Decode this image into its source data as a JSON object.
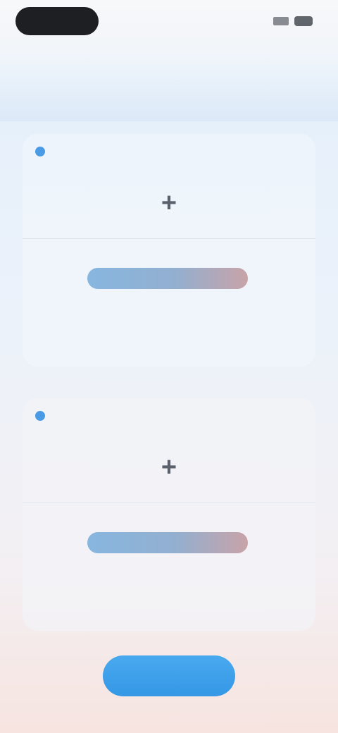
{
  "status_bar": {
    "time": "",
    "signal_icon": "signal-icon",
    "battery_icon": "battery-icon"
  },
  "cards": [
    {
      "title": "",
      "add_icon": "plus-icon",
      "button_label": ""
    },
    {
      "title": "",
      "add_icon": "plus-icon",
      "button_label": ""
    }
  ],
  "primary_button": {
    "label": ""
  },
  "colors": {
    "accent": "#3598e6",
    "bar_start": "#87b6df",
    "bar_end": "#c8a3a8"
  }
}
